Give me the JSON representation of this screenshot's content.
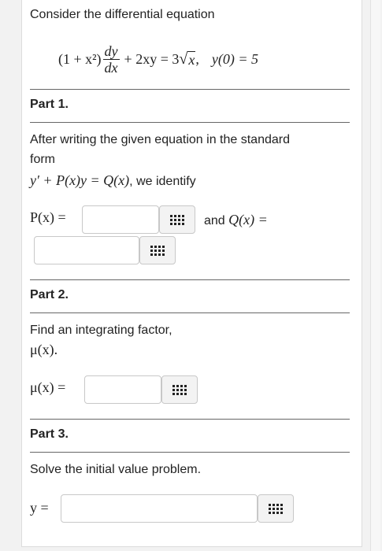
{
  "intro": "Consider the differential equation",
  "equation": {
    "lhs_factor": "(1 + x²)",
    "dy": "dy",
    "dx": "dx",
    "middle": "+ 2xy = 3",
    "radicand": "x",
    "sep": ",",
    "initial_condition": "y(0) = 5"
  },
  "part1": {
    "title": "Part 1.",
    "instruction_line1": "After writing the given equation in the standard",
    "instruction_line2": "form",
    "standard_form": "y′ + P(x)y = Q(x)",
    "identify_suffix": ", we identify",
    "p_label": "P(x) =",
    "and_text": "and",
    "q_label": "Q(x) =",
    "p_value": "",
    "q_value": ""
  },
  "part2": {
    "title": "Part 2.",
    "instruction_line1": "Find an integrating factor,",
    "instruction_line2": "μ(x).",
    "mu_label": "μ(x) =",
    "mu_value": ""
  },
  "part3": {
    "title": "Part 3.",
    "instruction": "Solve the initial value problem.",
    "y_label": "y =",
    "y_value": ""
  },
  "icons": {
    "palette": "symbol-palette-grid-icon"
  }
}
